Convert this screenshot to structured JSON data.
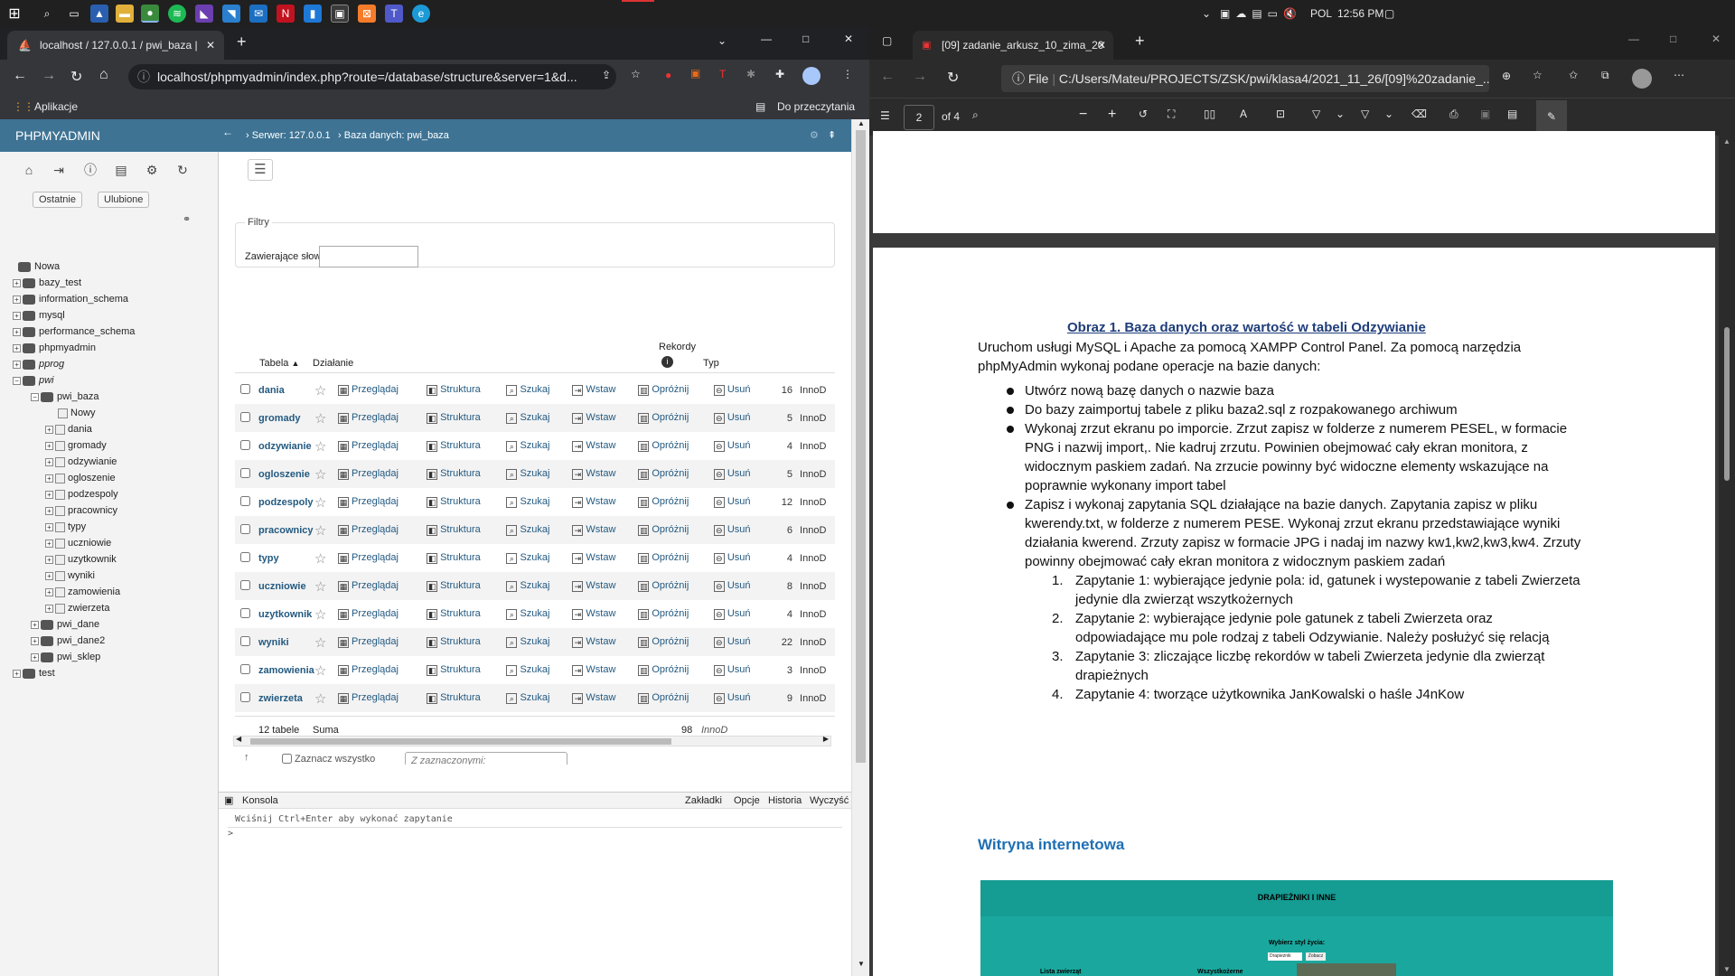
{
  "taskbar": {
    "lang": "POL",
    "time": "12:56 PM"
  },
  "chrome": {
    "tab_title": "localhost / 127.0.0.1 / pwi_baza |",
    "url": "localhost/phpmyadmin/index.php?route=/database/structure&server=1&d...",
    "bookmarks_label": "Aplikacje",
    "reading_list": "Do przeczytania"
  },
  "pma": {
    "logo": "PHPMYADMIN",
    "nav_recent": "Ostatnie",
    "nav_favorites": "Ulubione",
    "breadcrumb_server": "Serwer: 127.0.0.1",
    "breadcrumb_db": "Baza danych: pwi_baza",
    "filters_legend": "Filtry",
    "filters_label": "Zawierające słowo:",
    "col_table": "Tabela",
    "col_action": "Działanie",
    "col_records": "Rekordy",
    "col_type": "Typ",
    "actions": {
      "browse": "Przeglądaj",
      "structure": "Struktura",
      "search": "Szukaj",
      "insert": "Wstaw",
      "empty": "Opróżnij",
      "drop": "Usuń"
    },
    "tables": [
      {
        "name": "dania",
        "rows": "16",
        "type": "InnoD"
      },
      {
        "name": "gromady",
        "rows": "5",
        "type": "InnoD"
      },
      {
        "name": "odzywianie",
        "rows": "4",
        "type": "InnoD"
      },
      {
        "name": "ogloszenie",
        "rows": "5",
        "type": "InnoD"
      },
      {
        "name": "podzespoly",
        "rows": "12",
        "type": "InnoD"
      },
      {
        "name": "pracownicy",
        "rows": "6",
        "type": "InnoD"
      },
      {
        "name": "typy",
        "rows": "4",
        "type": "InnoD"
      },
      {
        "name": "uczniowie",
        "rows": "8",
        "type": "InnoD"
      },
      {
        "name": "uzytkownik",
        "rows": "4",
        "type": "InnoD"
      },
      {
        "name": "wyniki",
        "rows": "22",
        "type": "InnoD"
      },
      {
        "name": "zamowienia",
        "rows": "3",
        "type": "InnoD"
      },
      {
        "name": "zwierzeta",
        "rows": "9",
        "type": "InnoD"
      }
    ],
    "summary": {
      "count": "12 tabele",
      "label": "Suma",
      "rows": "98",
      "type": "InnoD"
    },
    "check_all": "Zaznacz wszystko",
    "with_selected": "Z zaznaczonymi:",
    "console": {
      "title": "Konsola",
      "bookmarks": "Zakładki",
      "options": "Opcje",
      "history": "Historia",
      "clear": "Wyczyść",
      "hint": "Wciśnij Ctrl+Enter aby wykonać zapytanie",
      "prompt": ">"
    },
    "tree": {
      "new": "Nowa",
      "databases": [
        "bazy_test",
        "information_schema",
        "mysql",
        "performance_schema",
        "phpmyadmin",
        "pprog",
        "pwi"
      ],
      "pwi_children": [
        "pwi_baza"
      ],
      "pwi_baza_new": "Nowy",
      "pwi_baza_tables": [
        "dania",
        "gromady",
        "odzywianie",
        "ogloszenie",
        "podzespoly",
        "pracownicy",
        "typy",
        "uczniowie",
        "uzytkownik",
        "wyniki",
        "zamowienia",
        "zwierzeta"
      ],
      "pwi_more": [
        "pwi_dane",
        "pwi_dane2",
        "pwi_sklep"
      ],
      "last": "test"
    }
  },
  "edge": {
    "tab_title": "[09] zadanie_arkusz_10_zima_20",
    "url_prefix": "File",
    "url": "C:/Users/Mateu/PROJECTS/ZSK/pwi/klasa4/2021_11_26/[09]%20zadanie_...",
    "page_current": "2",
    "page_total": "of 4"
  },
  "pdf": {
    "heading": "Obraz 1. Baza danych oraz wartość w tabeli Odzywianie",
    "intro": [
      "Uruchom usługi MySQL i Apache za pomocą XAMPP Control Panel. Za pomocą narzędzia",
      "phpMyAdmin wykonaj podane operacje na bazie danych:"
    ],
    "bullets": [
      [
        "Utwórz nową bazę danych o nazwie baza"
      ],
      [
        "Do bazy zaimportuj tabele z pliku baza2.sql z rozpakowanego archiwum"
      ],
      [
        "Wykonaj zrzut ekranu po imporcie. Zrzut zapisz w folderze z numerem PESEL, w formacie",
        "PNG i nazwij import,. Nie kadruj zrzutu. Powinien obejmować cały ekran monitora, z",
        "widocznym paskiem zadań. Na zrzucie powinny być widoczne elementy wskazujące na",
        "poprawnie wykonany import tabel"
      ],
      [
        "Zapisz i wykonaj zapytania SQL działające na bazie danych. Zapytania zapisz w pliku",
        "kwerendy.txt, w folderze z numerem PESE. Wykonaj zrzut ekranu przedstawiające wyniki",
        "działania kwerend. Zrzuty zapisz w formacie JPG i nadaj im nazwy kw1,kw2,kw3,kw4. Zrzuty",
        "powinny obejmować cały ekran monitora z widocznym paskiem zadań"
      ]
    ],
    "queries": [
      [
        "1.",
        "Zapytanie 1: wybierające jedynie pola: id, gatunek i wystepowanie z tabeli Zwierzeta",
        "jedynie dla zwierząt wszytkożernych"
      ],
      [
        "2.",
        "Zapytanie 2: wybierające jedynie pole gatunek z tabeli Zwierzeta oraz",
        "odpowiadające mu pole rodzaj z tabeli Odzywianie. Należy posłużyć się relacją"
      ],
      [
        "3.",
        "Zapytanie 3: zliczające liczbę rekordów w tabeli Zwierzeta jedynie dla zwierząt",
        "drapieżnych"
      ],
      [
        "4.",
        "Zapytanie 4: tworzące użytkownika JanKowalski o haśle J4nKow"
      ]
    ],
    "section": "Witryna internetowa",
    "site_title": "DRAPIEŻNIKI I INNE",
    "site_select_label": "Wybierz styl życia:",
    "site_select_value": "Drapieżnik",
    "site_button": "Zobacz",
    "site_list_title": "Lista zwierząt",
    "site_all": "Wszystkożerne"
  },
  "colors": {
    "pma_blue": "#3e7394",
    "link": "#235a81",
    "site_teal": "#1aa89e"
  }
}
